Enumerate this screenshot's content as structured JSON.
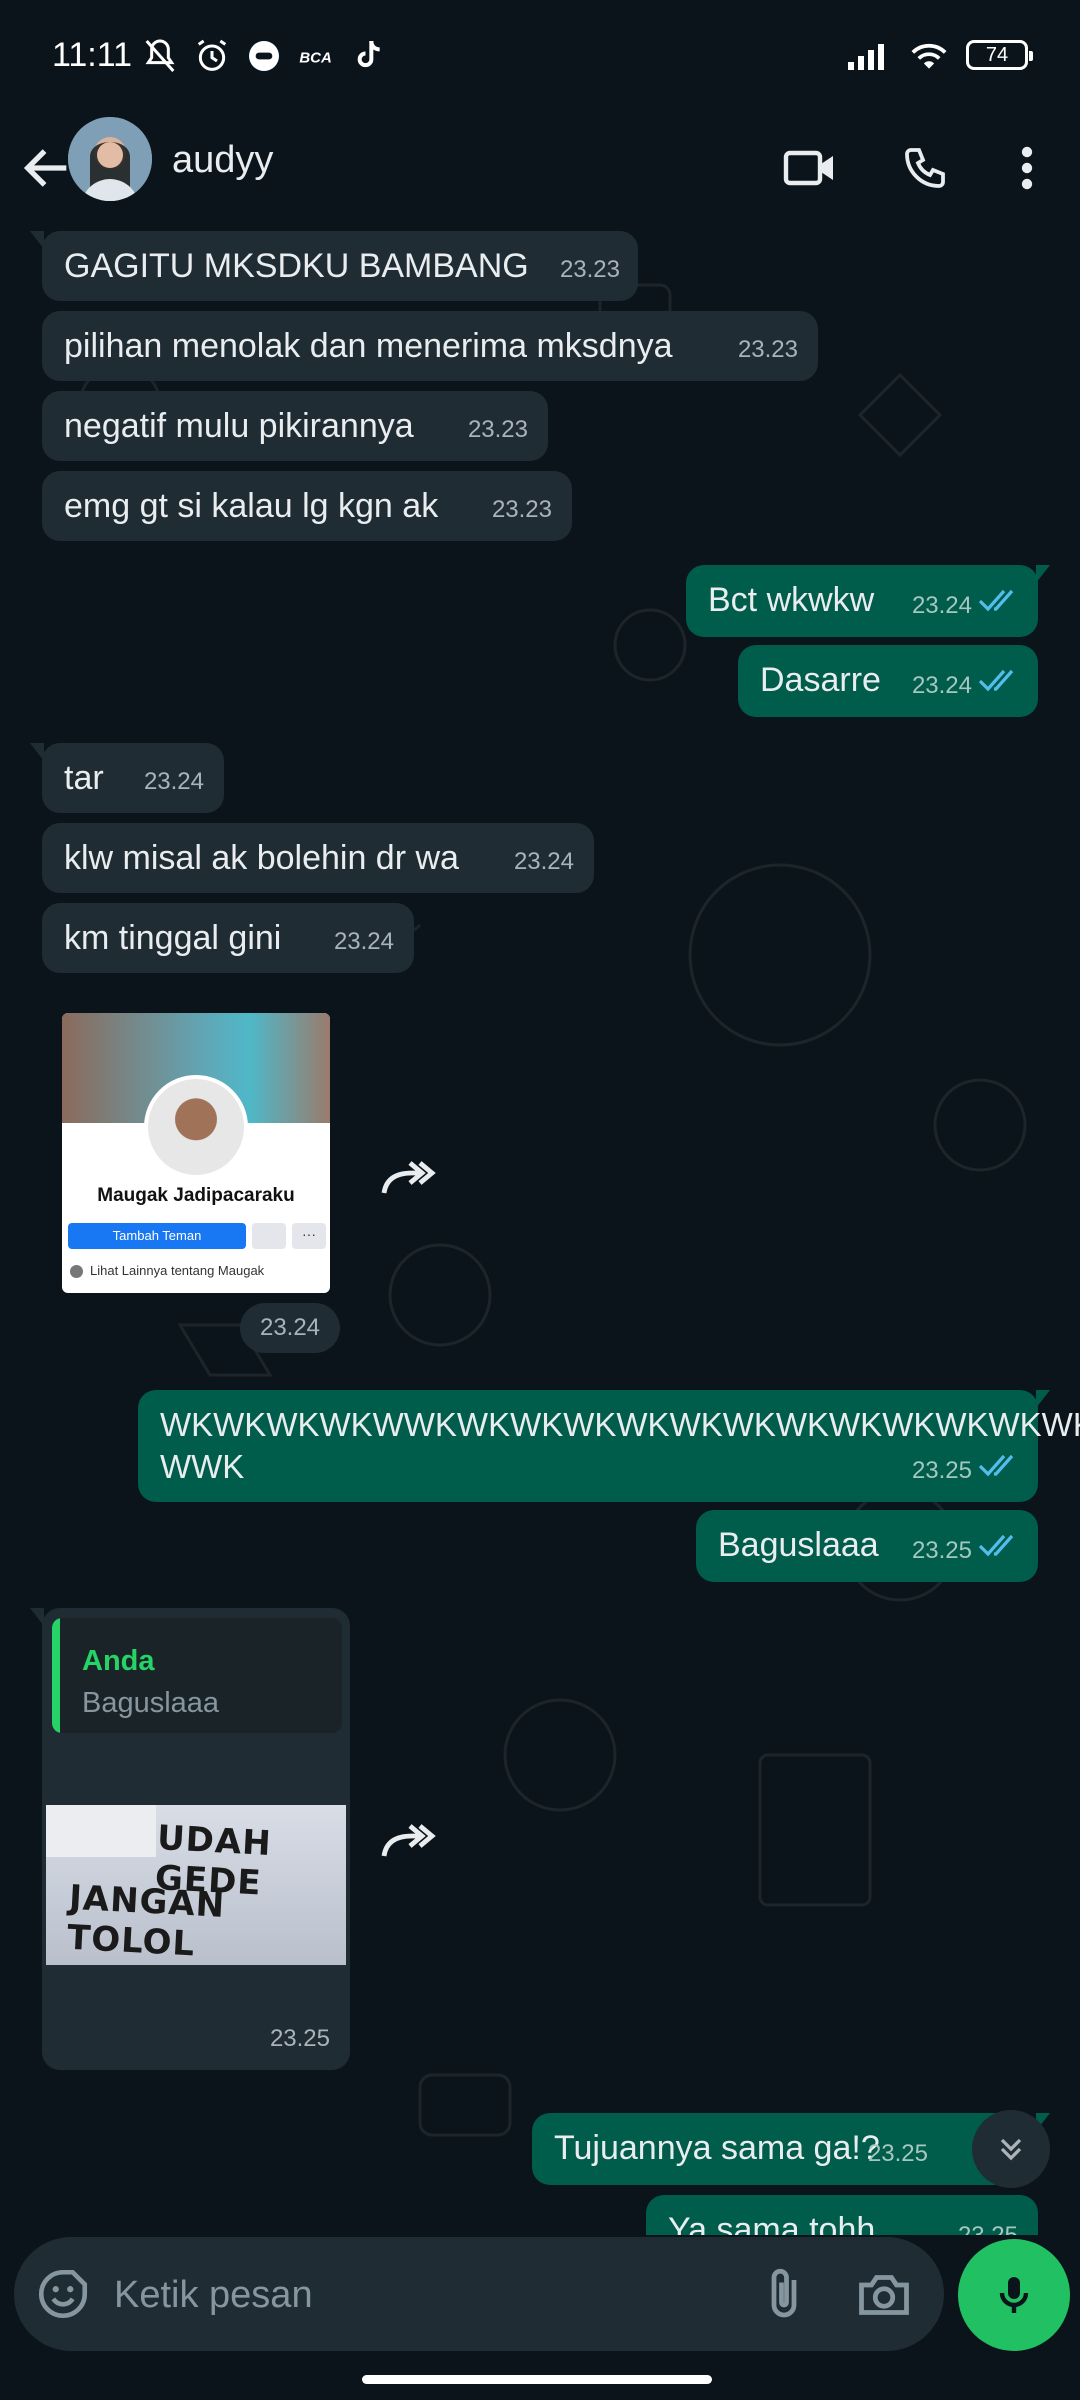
{
  "status": {
    "time": "11:11",
    "battery": "74"
  },
  "header": {
    "contact_name": "audyy"
  },
  "messages": [
    {
      "text": "GAGITU MKSDKU BAMBANG",
      "time": "23.23"
    },
    {
      "text": "pilihan menolak dan menerima mksdnya",
      "time": "23.23"
    },
    {
      "text": "negatif mulu pikirannya",
      "time": "23.23"
    },
    {
      "text": "emg gt si kalau lg kgn ak",
      "time": "23.23"
    },
    {
      "text": "Bct wkwkw",
      "time": "23.24"
    },
    {
      "text": "Dasarre",
      "time": "23.24"
    },
    {
      "text": "tar",
      "time": "23.24"
    },
    {
      "text": "klw misal ak bolehin dr wa",
      "time": "23.24"
    },
    {
      "text": "km tinggal gini",
      "time": "23.24"
    },
    {
      "text": "WKWKWKWKWWKWKWKWKWKWKWKWKWKWKWKWKWK\nWWK",
      "time": "23.25"
    },
    {
      "text": "Baguslaaa",
      "time": "23.25"
    },
    {
      "text": "Tujuannya sama ga!?",
      "time": "23.25"
    },
    {
      "text": "Ya sama tohh",
      "time": "23.25"
    }
  ],
  "image_card": {
    "name": "Maugak Jadipacaraku",
    "add_friend": "Tambah Teman",
    "more": "···",
    "see_more": "Lihat Lainnya tentang Maugak",
    "time": "23.24"
  },
  "reply": {
    "author": "Anda",
    "quoted": "Baguslaaa",
    "meme_line1": "UDAH GEDE",
    "meme_line2": "JANGAN TOLOL",
    "time": "23.25"
  },
  "composer": {
    "placeholder": "Ketik pesan"
  },
  "colors": {
    "accent": "#21c063",
    "outgoing": "#005c4b",
    "incoming": "#202c33",
    "background": "#0b141a",
    "read_ticks": "#53bdeb"
  },
  "icons": [
    "back-arrow-icon",
    "video-call-icon",
    "phone-icon",
    "more-vert-icon",
    "forward-icon",
    "double-check-icon",
    "scroll-down-icon",
    "emoji-icon",
    "attach-icon",
    "camera-icon",
    "mic-icon"
  ]
}
